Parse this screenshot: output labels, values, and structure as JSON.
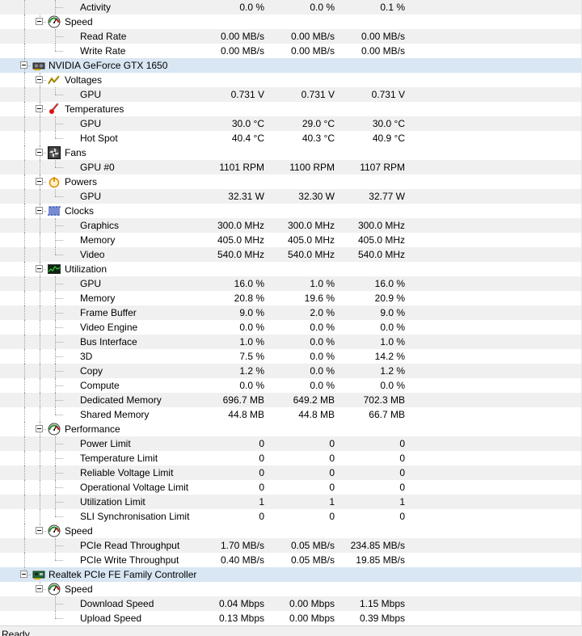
{
  "window": {
    "status": "Ready"
  },
  "rows": [
    {
      "level": 3,
      "label": "Activity",
      "values": [
        "0.0 %",
        "0.0 %",
        "0.1 %"
      ],
      "stripe": true,
      "last": false
    },
    {
      "level": 2,
      "group": "Speed",
      "icon": "gauge-icon",
      "last": true
    },
    {
      "level": 3,
      "label": "Read Rate",
      "values": [
        "0.00 MB/s",
        "0.00 MB/s",
        "0.00 MB/s"
      ],
      "stripe": true,
      "last": false
    },
    {
      "level": 3,
      "label": "Write Rate",
      "values": [
        "0.00 MB/s",
        "0.00 MB/s",
        "0.00 MB/s"
      ],
      "stripe": false,
      "last": true
    },
    {
      "level": 1,
      "hardware": "NVIDIA GeForce GTX 1650",
      "icon": "graphics-card-icon",
      "last": false
    },
    {
      "level": 2,
      "group": "Voltages",
      "icon": "voltage-icon",
      "last": false
    },
    {
      "level": 3,
      "label": "GPU",
      "values": [
        "0.731 V",
        "0.731 V",
        "0.731 V"
      ],
      "stripe": true,
      "last": true
    },
    {
      "level": 2,
      "group": "Temperatures",
      "icon": "thermometer-icon",
      "last": false
    },
    {
      "level": 3,
      "label": "GPU",
      "values": [
        "30.0 °C",
        "29.0 °C",
        "30.0 °C"
      ],
      "stripe": true,
      "last": false
    },
    {
      "level": 3,
      "label": "Hot Spot",
      "values": [
        "40.4 °C",
        "40.3 °C",
        "40.9 °C"
      ],
      "stripe": false,
      "last": true
    },
    {
      "level": 2,
      "group": "Fans",
      "icon": "fan-icon",
      "last": false
    },
    {
      "level": 3,
      "label": "GPU #0",
      "values": [
        "1101 RPM",
        "1100 RPM",
        "1107 RPM"
      ],
      "stripe": true,
      "last": true
    },
    {
      "level": 2,
      "group": "Powers",
      "icon": "power-icon",
      "last": false
    },
    {
      "level": 3,
      "label": "GPU",
      "values": [
        "32.31 W",
        "32.30 W",
        "32.77 W"
      ],
      "stripe": true,
      "last": true
    },
    {
      "level": 2,
      "group": "Clocks",
      "icon": "clock-icon",
      "last": false
    },
    {
      "level": 3,
      "label": "Graphics",
      "values": [
        "300.0 MHz",
        "300.0 MHz",
        "300.0 MHz"
      ],
      "stripe": true,
      "last": false
    },
    {
      "level": 3,
      "label": "Memory",
      "values": [
        "405.0 MHz",
        "405.0 MHz",
        "405.0 MHz"
      ],
      "stripe": false,
      "last": false
    },
    {
      "level": 3,
      "label": "Video",
      "values": [
        "540.0 MHz",
        "540.0 MHz",
        "540.0 MHz"
      ],
      "stripe": true,
      "last": true
    },
    {
      "level": 2,
      "group": "Utilization",
      "icon": "utilization-icon",
      "last": false
    },
    {
      "level": 3,
      "label": "GPU",
      "values": [
        "16.0 %",
        "1.0 %",
        "16.0 %"
      ],
      "stripe": true,
      "last": false
    },
    {
      "level": 3,
      "label": "Memory",
      "values": [
        "20.8 %",
        "19.6 %",
        "20.9 %"
      ],
      "stripe": false,
      "last": false
    },
    {
      "level": 3,
      "label": "Frame Buffer",
      "values": [
        "9.0 %",
        "2.0 %",
        "9.0 %"
      ],
      "stripe": true,
      "last": false
    },
    {
      "level": 3,
      "label": "Video Engine",
      "values": [
        "0.0 %",
        "0.0 %",
        "0.0 %"
      ],
      "stripe": false,
      "last": false
    },
    {
      "level": 3,
      "label": "Bus Interface",
      "values": [
        "1.0 %",
        "0.0 %",
        "1.0 %"
      ],
      "stripe": true,
      "last": false
    },
    {
      "level": 3,
      "label": "3D",
      "values": [
        "7.5 %",
        "0.0 %",
        "14.2 %"
      ],
      "stripe": false,
      "last": false
    },
    {
      "level": 3,
      "label": "Copy",
      "values": [
        "1.2 %",
        "0.0 %",
        "1.2 %"
      ],
      "stripe": true,
      "last": false
    },
    {
      "level": 3,
      "label": "Compute",
      "values": [
        "0.0 %",
        "0.0 %",
        "0.0 %"
      ],
      "stripe": false,
      "last": false
    },
    {
      "level": 3,
      "label": "Dedicated Memory",
      "values": [
        "696.7 MB",
        "649.2 MB",
        "702.3 MB"
      ],
      "stripe": true,
      "last": false
    },
    {
      "level": 3,
      "label": "Shared Memory",
      "values": [
        "44.8 MB",
        "44.8 MB",
        "66.7 MB"
      ],
      "stripe": false,
      "last": true
    },
    {
      "level": 2,
      "group": "Performance",
      "icon": "gauge-icon",
      "last": false
    },
    {
      "level": 3,
      "label": "Power Limit",
      "values": [
        "0",
        "0",
        "0"
      ],
      "stripe": true,
      "last": false
    },
    {
      "level": 3,
      "label": "Temperature Limit",
      "values": [
        "0",
        "0",
        "0"
      ],
      "stripe": false,
      "last": false
    },
    {
      "level": 3,
      "label": "Reliable Voltage Limit",
      "values": [
        "0",
        "0",
        "0"
      ],
      "stripe": true,
      "last": false
    },
    {
      "level": 3,
      "label": "Operational Voltage Limit",
      "values": [
        "0",
        "0",
        "0"
      ],
      "stripe": false,
      "last": false
    },
    {
      "level": 3,
      "label": "Utilization Limit",
      "values": [
        "1",
        "1",
        "1"
      ],
      "stripe": true,
      "last": false
    },
    {
      "level": 3,
      "label": "SLI Synchronisation Limit",
      "values": [
        "0",
        "0",
        "0"
      ],
      "stripe": false,
      "last": true
    },
    {
      "level": 2,
      "group": "Speed",
      "icon": "gauge-icon",
      "last": true
    },
    {
      "level": 3,
      "label": "PCIe Read Throughput",
      "values": [
        "1.70 MB/s",
        "0.05 MB/s",
        "234.85 MB/s"
      ],
      "stripe": true,
      "last": false
    },
    {
      "level": 3,
      "label": "PCIe Write Throughput",
      "values": [
        "0.40 MB/s",
        "0.05 MB/s",
        "19.85 MB/s"
      ],
      "stripe": false,
      "last": true
    },
    {
      "level": 1,
      "hardware": "Realtek PCIe FE Family Controller",
      "icon": "network-card-icon",
      "last": true
    },
    {
      "level": 2,
      "group": "Speed",
      "icon": "gauge-icon",
      "last": true
    },
    {
      "level": 3,
      "label": "Download Speed",
      "values": [
        "0.04 Mbps",
        "0.00 Mbps",
        "1.15 Mbps"
      ],
      "stripe": true,
      "last": false
    },
    {
      "level": 3,
      "label": "Upload Speed",
      "values": [
        "0.13 Mbps",
        "0.00 Mbps",
        "0.39 Mbps"
      ],
      "stripe": false,
      "last": true
    }
  ]
}
